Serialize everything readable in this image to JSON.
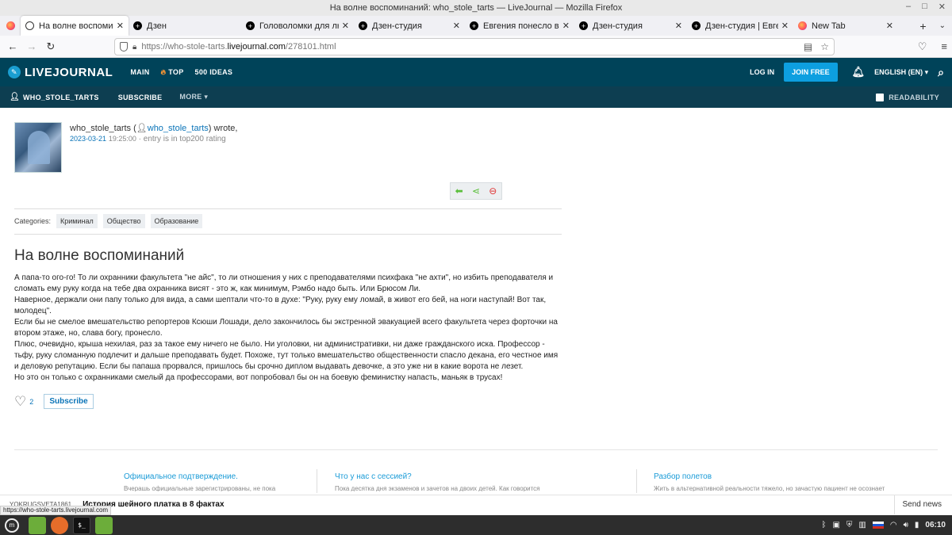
{
  "window": {
    "title": "На волне воспоминаний: who_stole_tarts — LiveJournal — Mozilla Firefox"
  },
  "tabs": [
    {
      "title": "На волне воспоминаний: w",
      "icon": "user-icon",
      "active": true
    },
    {
      "title": "Дзен",
      "icon": "dzen-icon"
    },
    {
      "title": "Головоломки для любозна",
      "icon": "dzen-icon"
    },
    {
      "title": "Дзен-студия",
      "icon": "dzen-icon"
    },
    {
      "title": "Евгения понесло в воспом",
      "icon": "dzen-icon"
    },
    {
      "title": "Дзен-студия",
      "icon": "dzen-icon"
    },
    {
      "title": "Дзен-студия | Евгения поне",
      "icon": "dzen-icon"
    },
    {
      "title": "New Tab",
      "icon": "firefox-icon"
    }
  ],
  "url": {
    "prefix": "https://who-stole-tarts.",
    "domain": "livejournal.com",
    "path": "/278101.html"
  },
  "lj": {
    "logo": "LIVEJOURNAL",
    "menu": [
      "MAIN",
      "TOP",
      "500 IDEAS"
    ],
    "login": "LOG IN",
    "join": "JOIN FREE",
    "language": "ENGLISH (EN)"
  },
  "journal_bar": {
    "user": "WHO_STOLE_TARTS",
    "subscribe": "SUBSCRIBE",
    "more": "MORE",
    "readability": "READABILITY"
  },
  "post": {
    "author": "who_stole_tarts",
    "author_link": "who_stole_tarts",
    "wrote": "wrote,",
    "date": "2023-03-21",
    "time": "19:25:00",
    "rating": "entry is in top200 rating",
    "categories_label": "Categories:",
    "categories": [
      "Криминал",
      "Общество",
      "Образование"
    ],
    "title": "На волне воспоминаний",
    "paragraphs": [
      "А папа-то ого-го! То ли охранники факультета \"не айс\", то ли отношения у них с преподавателями психфака \"не ахти\", но избить преподавателя и сломать ему руку когда на тебе два охранника висят - это ж, как минимум, Рэмбо надо быть. Или Брюсом Ли.",
      "Наверное, держали они папу только для вида, а сами шептали что-то в духе: \"Руку, руку ему ломай, в живот его бей, на ноги наступай! Вот так, молодец\".",
      "Если бы не смелое вмешательство репортеров Ксюши Лошади, дело закончилось бы экстренной эвакуацией всего факультета через форточки на втором этаже, но, слава богу, пронесло.",
      "Плюс, очевидно, крыша нехилая, раз за такое ему ничего не было. Ни уголовки, ни административки, ни даже гражданского иска. Профессор - тьфу, руку сломанную подлечит и дальше преподавать будет. Похоже, тут только вмешательство общественности спасло декана, его честное имя и деловую репутацию. Если бы папаша прорвался, пришлось бы срочно диплом выдавать девочке, а это уже ни в какие ворота не лезет.",
      "Но это он только с охранниками смелый да профессорами, вот попробовал бы он на боевую феминистку напасть, маньяк в трусах!"
    ],
    "likes": "2",
    "subscribe": "Subscribe"
  },
  "recommended": [
    {
      "title": "Официальное подтверждение.",
      "teaser": "Вчерашь официальные зарегистрированы, не пока"
    },
    {
      "title": "Что у нас с сессией?",
      "teaser": "Пока десятка дня экзаменов и зачетов на двоих детей. Как говорится"
    },
    {
      "title": "Разбор полетов",
      "teaser": "Жить в альтернативной реальности тяжело, но зачастую пациент не осознает"
    }
  ],
  "news": {
    "source": "yokrugsveta1861",
    "title": "История шейного платка в 8 фактах",
    "send": "Send news"
  },
  "status_url": "https://who-stole-tarts.livejournal.com",
  "taskbar": {
    "clock": "06:10"
  }
}
